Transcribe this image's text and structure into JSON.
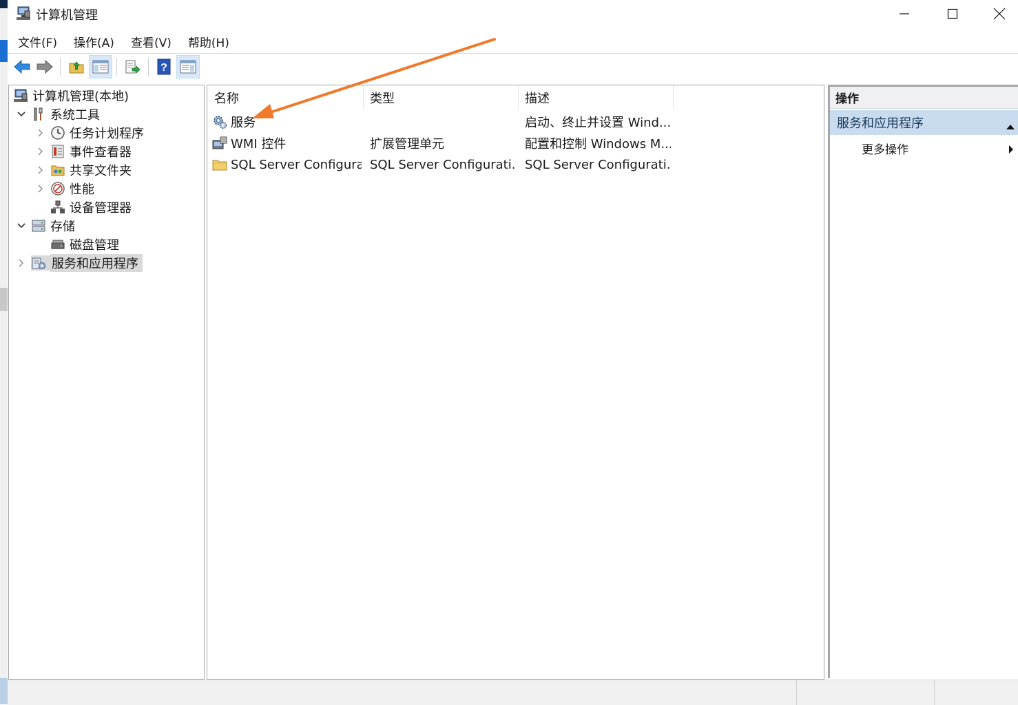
{
  "window": {
    "title": "计算机管理",
    "minimize_icon": "minimize-icon",
    "maximize_icon": "maximize-icon",
    "close_icon": "close-icon"
  },
  "menu": [
    "文件(F)",
    "操作(A)",
    "查看(V)",
    "帮助(H)"
  ],
  "toolbar": {
    "buttons": [
      "back-arrow-icon",
      "forward-arrow-icon",
      "up-folder-icon",
      "show-hide-console-tree-icon",
      "export-list-icon",
      "help-icon",
      "show-hide-action-pane-icon"
    ]
  },
  "tree": {
    "root": "计算机管理(本地)",
    "system_tools": "系统工具",
    "task_scheduler": "任务计划程序",
    "event_viewer": "事件查看器",
    "shared_folders": "共享文件夹",
    "performance": "性能",
    "device_manager": "设备管理器",
    "storage": "存储",
    "disk_management": "磁盘管理",
    "services_apps": "服务和应用程序"
  },
  "list": {
    "columns": [
      "名称",
      "类型",
      "描述"
    ],
    "rows": [
      {
        "name": "服务",
        "type": "",
        "desc": "启动、终止并设置 Wind..."
      },
      {
        "name": "WMI 控件",
        "type": "扩展管理单元",
        "desc": "配置和控制 Windows M..."
      },
      {
        "name": "SQL Server Configura...",
        "type": "SQL Server Configurati...",
        "desc": "SQL Server Configurati..."
      }
    ]
  },
  "actions": {
    "header": "操作",
    "section": "服务和应用程序",
    "more": "更多操作"
  },
  "colors": {
    "selection": "#d9d9d9",
    "action_section_bg": "#c9dcef",
    "annotation_arrow": "#f07a2b"
  }
}
